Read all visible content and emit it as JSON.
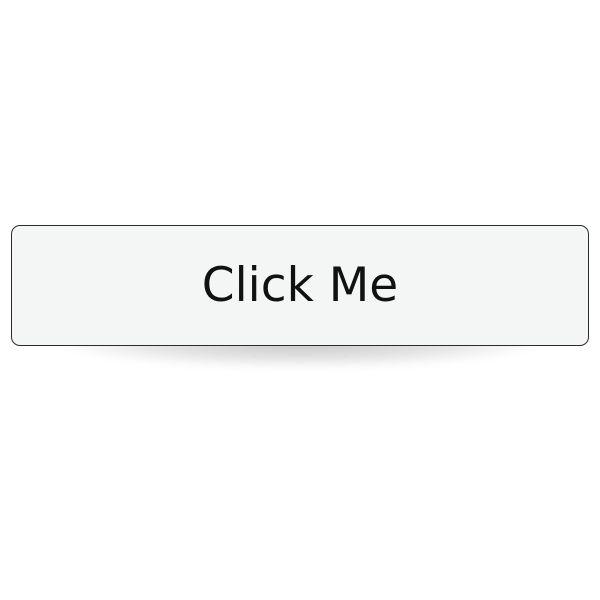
{
  "button": {
    "label": "Click Me"
  },
  "colors": {
    "background": "#ffffff",
    "button_fill": "#f4f6f5",
    "button_border": "#2b2b2b",
    "text": "#111111"
  }
}
